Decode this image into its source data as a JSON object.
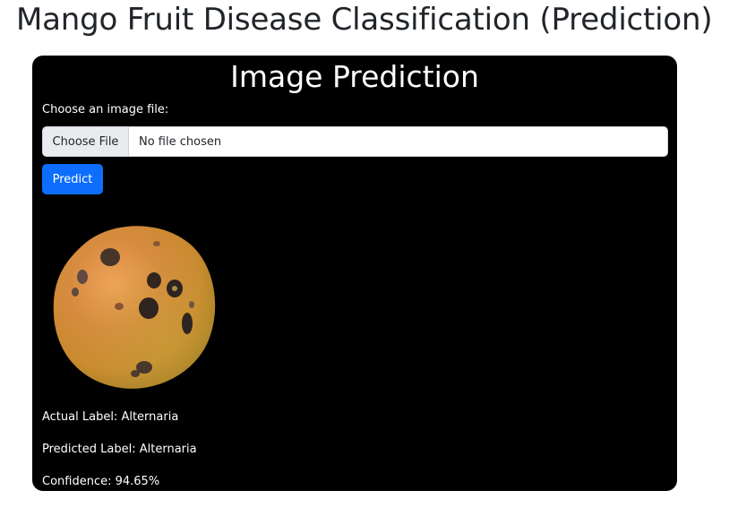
{
  "page": {
    "title": "Mango Fruit Disease Classification (Prediction)"
  },
  "card": {
    "title": "Image Prediction",
    "file_label": "Choose an image file:",
    "file_button_label": "Choose File",
    "file_status": "No file chosen",
    "predict_label": "Predict"
  },
  "image": {
    "subject": "mango fruit with dark disease spots"
  },
  "results": {
    "actual": "Actual Label: Alternaria",
    "predicted": "Predicted Label: Alternaria",
    "confidence": "Confidence: 94.65%"
  },
  "colors": {
    "card_background": "#000000",
    "primary_button": "#0d6efd",
    "page_text": "#212529"
  }
}
